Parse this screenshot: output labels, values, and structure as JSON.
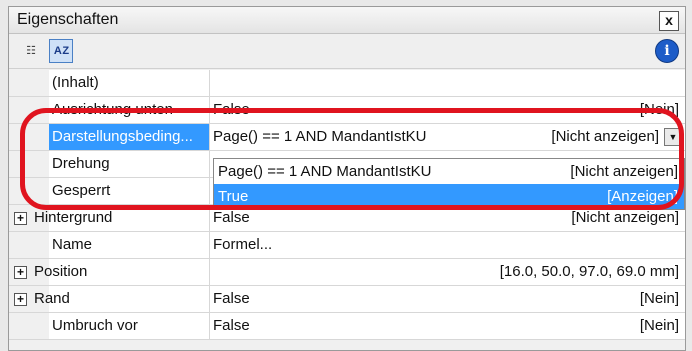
{
  "panel": {
    "title": "Eigenschaften",
    "close_label": "x"
  },
  "toolbar": {
    "alpha_label": "A Z"
  },
  "rows": [
    {
      "name": "(Inhalt)",
      "value": "",
      "display": ""
    },
    {
      "name": "Ausrichtung unten",
      "value": "False",
      "display": "[Nein]"
    },
    {
      "name": "Darstellungsbeding...",
      "value": "Page() == 1 AND MandantIstKU",
      "display": "[Nicht anzeigen]"
    },
    {
      "name": "Drehung",
      "value": "",
      "display": ""
    },
    {
      "name": "Gesperrt",
      "value": "",
      "display": ""
    },
    {
      "name": "Hintergrund",
      "value": "False",
      "display": "[Nicht anzeigen]"
    },
    {
      "name": "Name",
      "value": "Formel...",
      "display": ""
    },
    {
      "name": "Position",
      "value": "",
      "display": "[16.0, 50.0, 97.0, 69.0 mm]"
    },
    {
      "name": "Rand",
      "value": "False",
      "display": "[Nein]"
    },
    {
      "name": "Umbruch vor",
      "value": "False",
      "display": "[Nein]"
    }
  ],
  "dropdown": {
    "options": [
      {
        "value": "Page() == 1 AND MandantIstKU",
        "display": "[Nicht anzeigen]"
      },
      {
        "value": "True",
        "display": "[Anzeigen]"
      }
    ]
  }
}
